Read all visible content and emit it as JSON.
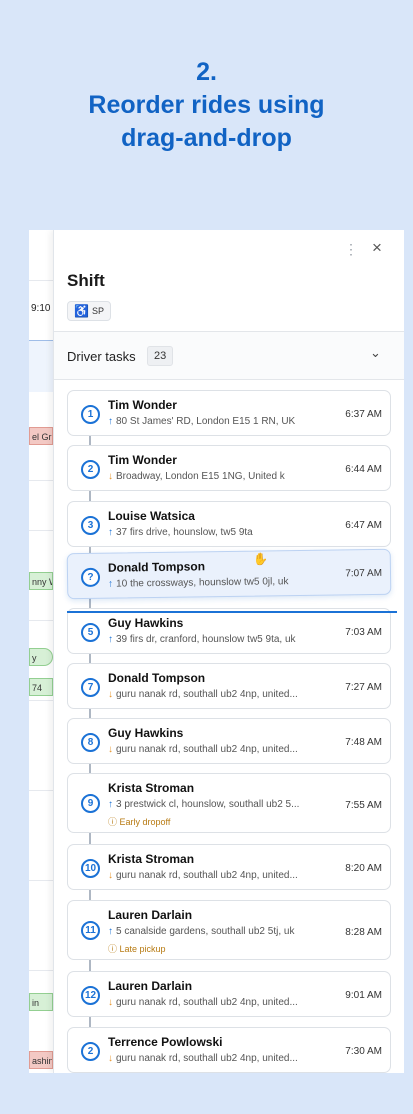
{
  "headline": {
    "step": "2.",
    "line1": "Reorder rides using",
    "line2": "drag-and-drop"
  },
  "background": {
    "time_label": "9:10",
    "chips": [
      {
        "text": "el Gr",
        "color": "#f3c9c4",
        "border": "#e19b92"
      },
      {
        "text": "nny W",
        "color": "#d7f0d6",
        "border": "#93cf91"
      },
      {
        "text": "y",
        "color": "#d7f0d6",
        "border": "#93cf91"
      },
      {
        "text": "74",
        "color": "#d7f0d6",
        "border": "#93cf91"
      },
      {
        "text": "in",
        "color": "#d7f0d6",
        "border": "#93cf91"
      },
      {
        "text": "ashin",
        "color": "#f3c9c4",
        "border": "#e19b92"
      }
    ]
  },
  "panel": {
    "kebab_icon": "kebab-menu-icon",
    "close_icon": "close-icon",
    "title": "Shift",
    "tag_icon": "wheelchair-icon",
    "tag": "SP",
    "section_label": "Driver tasks",
    "section_count": "23",
    "collapse_icon": "chevron-down-icon"
  },
  "tasks": [
    {
      "num": "1",
      "name": "Tim Wonder",
      "dir": "up",
      "address": "80 St James' RD, London E15 1 RN, UK",
      "time": "6:37 AM"
    },
    {
      "num": "2",
      "name": "Tim Wonder",
      "dir": "down",
      "address": "Broadway, London E15 1NG, United k",
      "time": "6:44 AM"
    },
    {
      "num": "3",
      "name": "Louise Watsica",
      "dir": "up",
      "address": "37 firs drive, hounslow, tw5 9ta",
      "time": "6:47 AM"
    },
    {
      "num": "?",
      "name": "Donald Tompson",
      "dir": "up",
      "address": "10 the crossways, hounslow tw5 0jl, uk",
      "time": "7:07 AM",
      "dragging": true
    },
    {
      "num": "5",
      "name": "Guy Hawkins",
      "dir": "up",
      "address": "39 firs dr, cranford, hounslow tw5 9ta, uk",
      "time": "7:03 AM"
    },
    {
      "num": "7",
      "name": "Donald Tompson",
      "dir": "down",
      "address": "guru nanak rd, southall ub2 4np, united...",
      "time": "7:27 AM"
    },
    {
      "num": "8",
      "name": "Guy Hawkins",
      "dir": "down",
      "address": "guru nanak rd, southall ub2 4np, united...",
      "time": "7:48 AM"
    },
    {
      "num": "9",
      "name": "Krista Stroman",
      "dir": "up",
      "address": "3 prestwick cl, hounslow, southall ub2 5...",
      "time": "7:55 AM",
      "warning": "Early dropoff"
    },
    {
      "num": "10",
      "name": "Krista Stroman",
      "dir": "down",
      "address": "guru nanak rd, southall ub2 4np, united...",
      "time": "8:20 AM"
    },
    {
      "num": "11",
      "name": "Lauren Darlain",
      "dir": "up",
      "address": "5 canalside gardens, southall ub2 5tj, uk",
      "time": "8:28 AM",
      "warning": "Late pickup"
    },
    {
      "num": "12",
      "name": "Lauren Darlain",
      "dir": "down",
      "address": "guru nanak rd, southall ub2 4np, united...",
      "time": "9:01 AM"
    },
    {
      "num": "2",
      "name": "Terrence Powlowski",
      "dir": "down",
      "address": "guru nanak rd, southall ub2 4np, united...",
      "time": "7:30 AM"
    }
  ]
}
